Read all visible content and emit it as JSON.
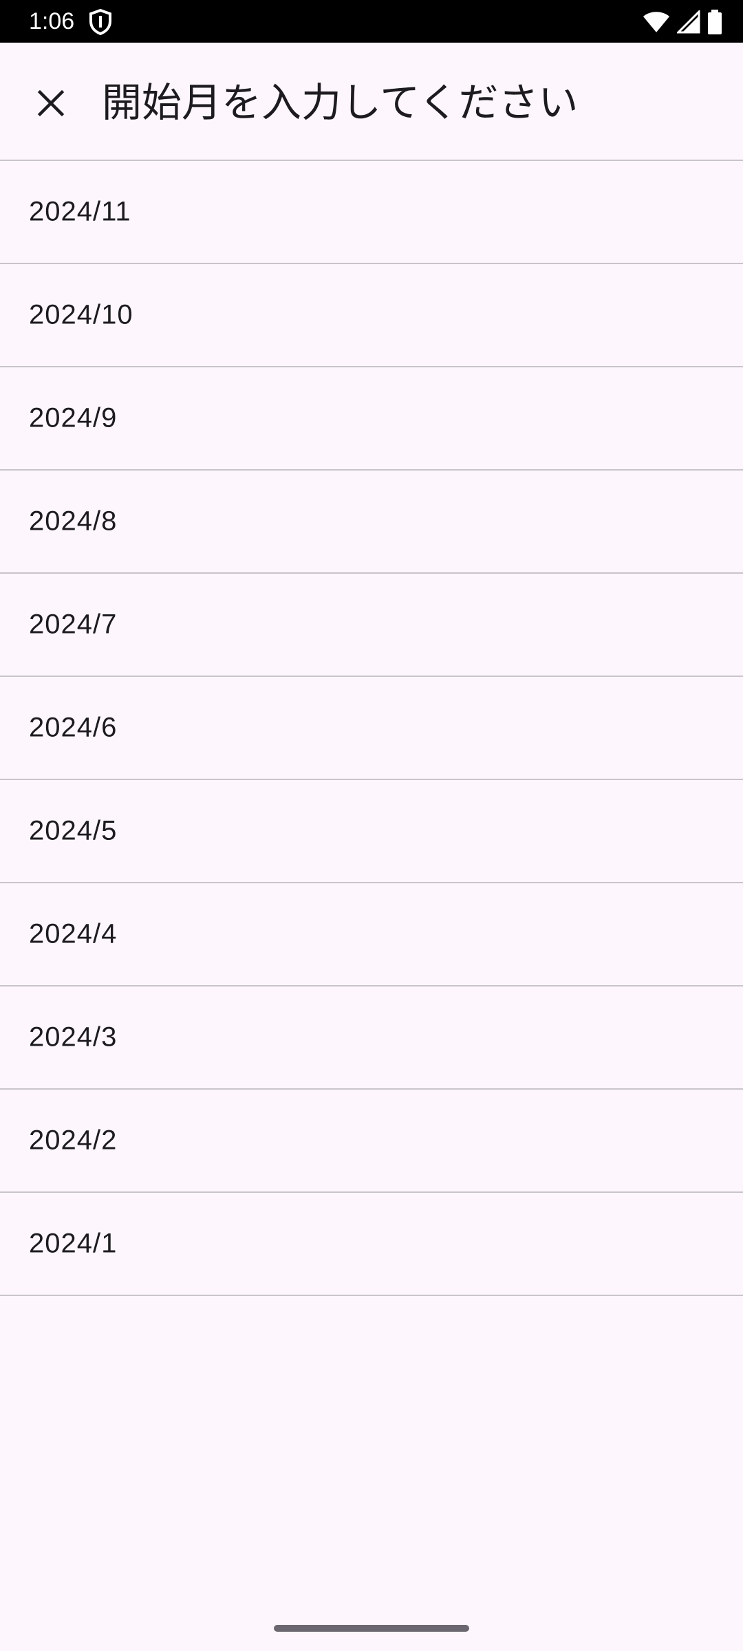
{
  "status_bar": {
    "time": "1:06",
    "icons": [
      "shield-icon",
      "wifi-icon",
      "signal-icon",
      "battery-icon"
    ]
  },
  "app_bar": {
    "close_icon": "close-icon",
    "title": "開始月を入力してください"
  },
  "months": [
    "2024/11",
    "2024/10",
    "2024/9",
    "2024/8",
    "2024/7",
    "2024/6",
    "2024/5",
    "2024/4",
    "2024/3",
    "2024/2",
    "2024/1"
  ],
  "colors": {
    "background": "#fdf7fd",
    "text": "#1d1b20",
    "divider": "#c9c4cb",
    "status_bar": "#000000"
  }
}
